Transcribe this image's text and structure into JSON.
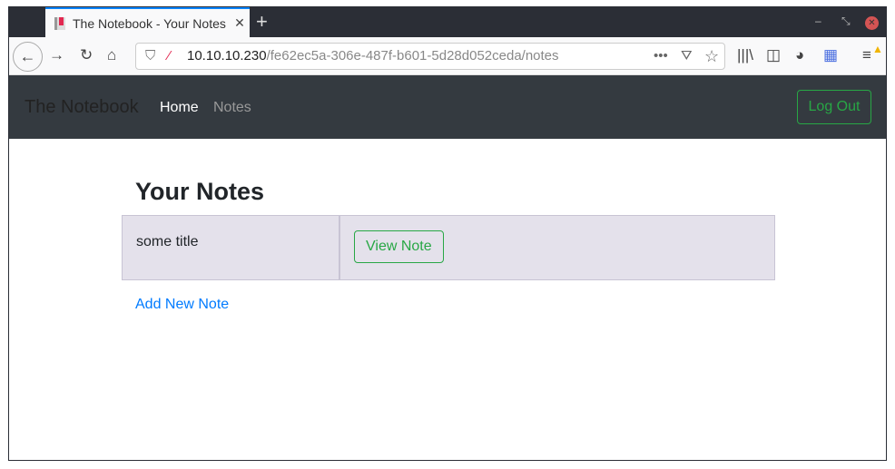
{
  "browser": {
    "tab_title": "The Notebook - Your Notes",
    "url_host": "10.10.10.230",
    "url_path": "/fe62ec5a-306e-487f-b601-5d28d052ceda/notes"
  },
  "navbar": {
    "brand": "The Notebook",
    "links": [
      "Home",
      "Notes"
    ],
    "logout": "Log Out"
  },
  "main": {
    "heading": "Your Notes",
    "notes": [
      {
        "title": "some title",
        "action": "View Note"
      }
    ],
    "add_link": "Add New Note"
  },
  "colors": {
    "accent": "#28a745",
    "link": "#007bff",
    "navbar": "#343a40"
  }
}
